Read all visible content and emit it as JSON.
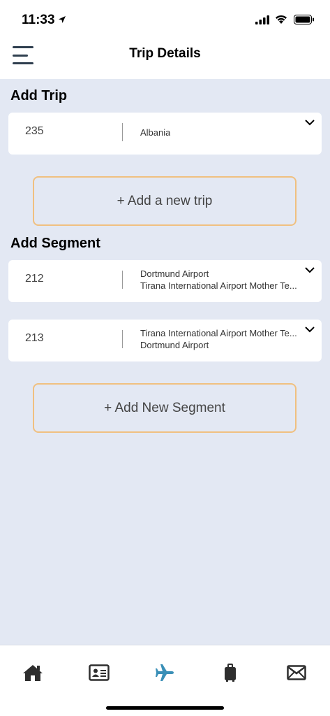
{
  "status": {
    "time": "11:33"
  },
  "header": {
    "title": "Trip Details"
  },
  "trip_section": {
    "title": "Add Trip",
    "trips": [
      {
        "id": "235",
        "line1": "Albania"
      }
    ],
    "add_button": "+ Add a new trip"
  },
  "segment_section": {
    "title": "Add Segment",
    "segments": [
      {
        "id": "212",
        "line1": "Dortmund Airport",
        "line2": "Tirana International Airport Mother Te..."
      },
      {
        "id": "213",
        "line1": "Tirana International Airport Mother Te...",
        "line2": "Dortmund Airport"
      }
    ],
    "add_button": "+ Add New Segment"
  },
  "tab_bar": {
    "items": [
      {
        "icon": "home-icon"
      },
      {
        "icon": "id-card-icon"
      },
      {
        "icon": "airplane-icon",
        "active": true
      },
      {
        "icon": "luggage-icon"
      },
      {
        "icon": "mail-icon"
      }
    ],
    "active_color": "#3a8fb7",
    "inactive_color": "#2e2e2e"
  },
  "colors": {
    "background": "#e3e8f3",
    "button_border": "#f0c080"
  }
}
